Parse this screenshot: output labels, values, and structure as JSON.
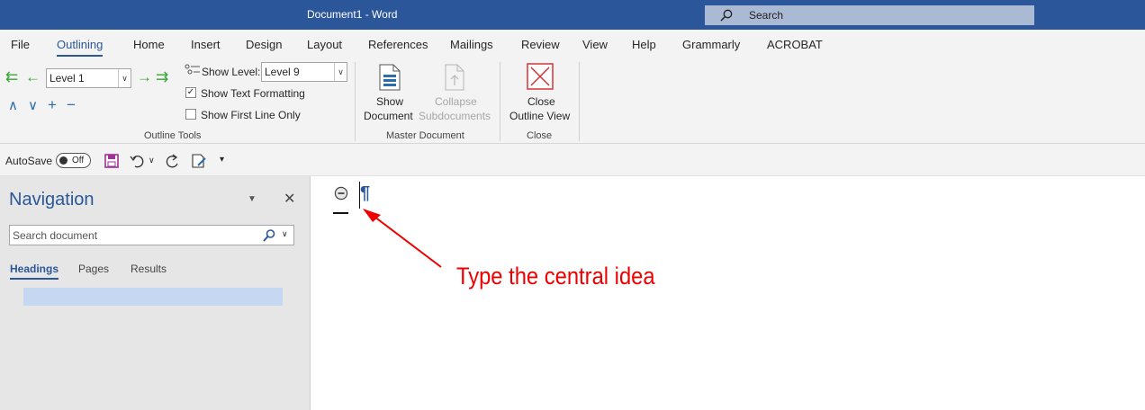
{
  "app": {
    "title": "Document1  -  Word",
    "search_label": "Search"
  },
  "ribbon_tabs": [
    "File",
    "Outlining",
    "Home",
    "Insert",
    "Design",
    "Layout",
    "References",
    "Mailings",
    "Review",
    "View",
    "Help",
    "Grammarly",
    "ACROBAT"
  ],
  "outline_tools": {
    "level_value": "Level 1",
    "show_level_label": "Show Level:",
    "show_level_value": "Level 9",
    "show_text_formatting": "Show Text Formatting",
    "show_text_formatting_checked": true,
    "show_first_line_only": "Show First Line Only",
    "show_first_line_only_checked": false,
    "group_label": "Outline Tools"
  },
  "master_document": {
    "show_document_line1": "Show",
    "show_document_line2": "Document",
    "collapse_line1": "Collapse",
    "collapse_line2": "Subdocuments",
    "group_label": "Master Document"
  },
  "close_group": {
    "close_line1": "Close",
    "close_line2": "Outline View",
    "group_label": "Close"
  },
  "qat": {
    "autosave_label": "AutoSave",
    "toggle_state": "Off"
  },
  "navigation": {
    "title": "Navigation",
    "search_placeholder": "Search document",
    "tabs": [
      "Headings",
      "Pages",
      "Results"
    ]
  },
  "document": {
    "pilcrow": "¶",
    "annotation": "Type the central idea"
  },
  "colors": {
    "brand": "#2b579a",
    "annotation": "#ee0000",
    "green_arrow": "#3aa535"
  }
}
